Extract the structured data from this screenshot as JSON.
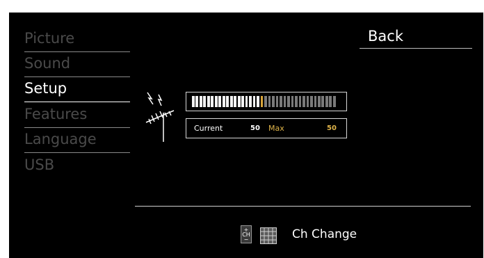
{
  "menu": {
    "items": [
      {
        "label": "Picture",
        "active": false
      },
      {
        "label": "Sound",
        "active": false
      },
      {
        "label": "Setup",
        "active": true
      },
      {
        "label": "Features",
        "active": false
      },
      {
        "label": "Language",
        "active": false
      },
      {
        "label": "USB",
        "active": false
      }
    ]
  },
  "back_label": "Back",
  "signal": {
    "current_label": "Current",
    "current_value": "50",
    "max_label": "Max",
    "max_value": "50",
    "level_fraction": 0.5
  },
  "footer": {
    "ch_icon_text": "+\nCH\n−",
    "action_label": "Ch Change"
  },
  "colors": {
    "screen_bg": "#000000",
    "active_text": "#ffffff",
    "inactive_text": "#4a4a4a",
    "accent": "#e0b54a"
  }
}
